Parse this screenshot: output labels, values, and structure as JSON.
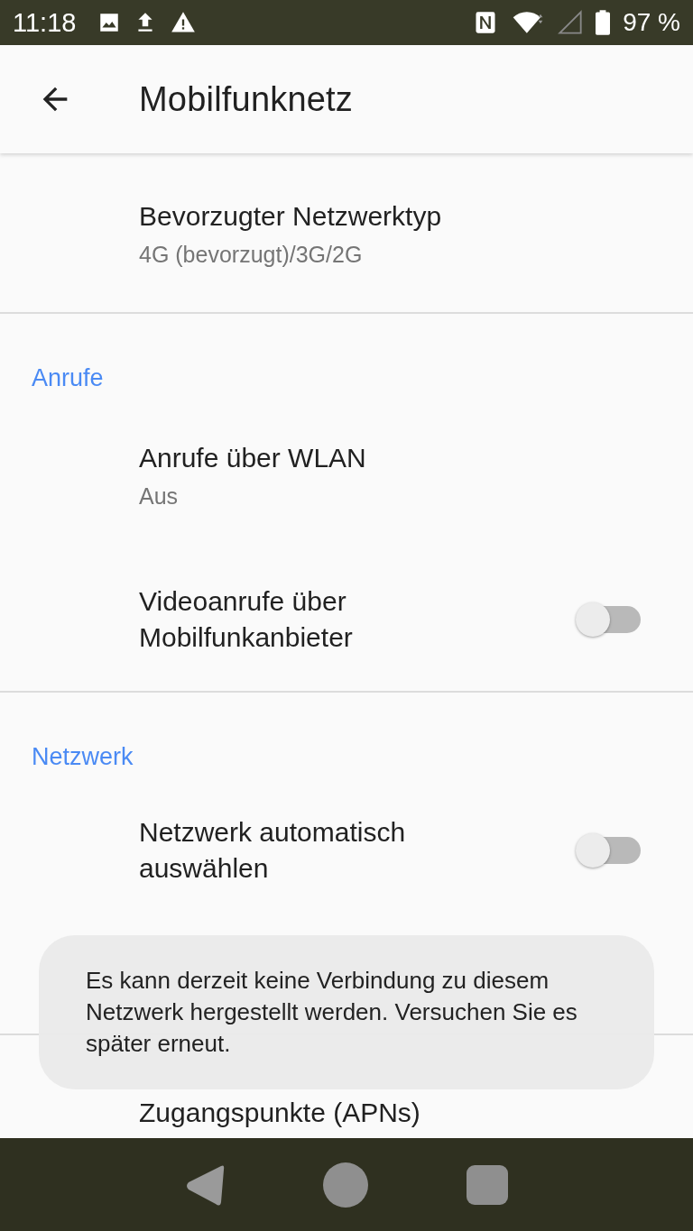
{
  "status_bar": {
    "time": "11:18",
    "battery": "97 %"
  },
  "app_bar": {
    "title": "Mobilfunknetz"
  },
  "sections": [
    {
      "items": [
        {
          "kind": "text",
          "title": "Bevorzugter Netzwerktyp",
          "summary": "4G (bevorzugt)/3G/2G"
        }
      ]
    },
    {
      "header": "Anrufe",
      "items": [
        {
          "kind": "text",
          "title": "Anrufe über WLAN",
          "summary": "Aus"
        },
        {
          "kind": "switch",
          "title": "Videoanrufe über Mobilfunkanbieter",
          "checked": false
        }
      ]
    },
    {
      "header": "Netzwerk",
      "items": [
        {
          "kind": "switch",
          "title": "Netzwerk automatisch auswählen",
          "checked": false
        },
        {
          "kind": "hidden"
        }
      ]
    },
    {
      "items": [
        {
          "kind": "text",
          "title": "Zugangspunkte (APNs)"
        }
      ]
    }
  ],
  "toast": {
    "message": "Es kann derzeit keine Verbindung zu diesem Netzwerk hergestellt werden. Versuchen Sie es später erneut."
  }
}
